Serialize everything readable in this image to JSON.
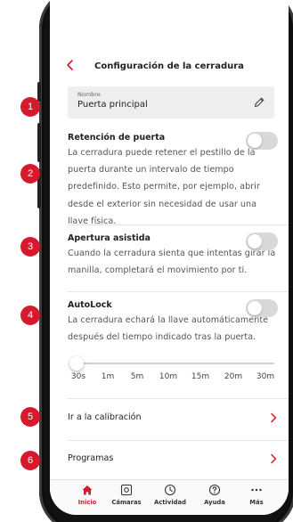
{
  "colors": {
    "accent": "#d7192d",
    "toggle_off": "#d9d9d9",
    "field_bg": "#eeeeee"
  },
  "header": {
    "title": "Configuración de la cerradura",
    "back_icon": "chevron-left-icon"
  },
  "name_field": {
    "label": "Nombre",
    "value": "Puerta principal",
    "icon": "pencil-icon"
  },
  "settings": [
    {
      "title": "Retención de puerta",
      "description": "La cerradura puede retener el pestillo de la puerta durante un intervalo de tiempo predefinido. Esto permite, por ejemplo, abrir desde el exterior sin necesidad de usar una llave física.",
      "enabled": false
    },
    {
      "title": "Apertura asistida",
      "description": "Cuando la cerradura sienta que intentas girar la manilla, completará el movimiento por ti.",
      "enabled": false
    },
    {
      "title": "AutoLock",
      "description": "La cerradura echará la llave automáticamente después del tiempo indicado tras la puerta.",
      "enabled": false
    }
  ],
  "autolock_slider": {
    "ticks": [
      "30s",
      "1m",
      "5m",
      "10m",
      "15m",
      "20m",
      "30m"
    ],
    "selected": "30s"
  },
  "links": [
    {
      "label": "Ir a la calibración",
      "icon": "chevron-right-icon"
    },
    {
      "label": "Programas",
      "icon": "chevron-right-icon"
    }
  ],
  "bottom_nav": [
    {
      "label": "Inicio",
      "icon": "home-icon",
      "active": true
    },
    {
      "label": "Cámaras",
      "icon": "camera-icon",
      "active": false
    },
    {
      "label": "Actividad",
      "icon": "clock-icon",
      "active": false
    },
    {
      "label": "Ayuda",
      "icon": "help-icon",
      "active": false
    },
    {
      "label": "Más",
      "icon": "more-icon",
      "active": false
    }
  ],
  "badges": [
    "1",
    "2",
    "3",
    "4",
    "5",
    "6"
  ]
}
